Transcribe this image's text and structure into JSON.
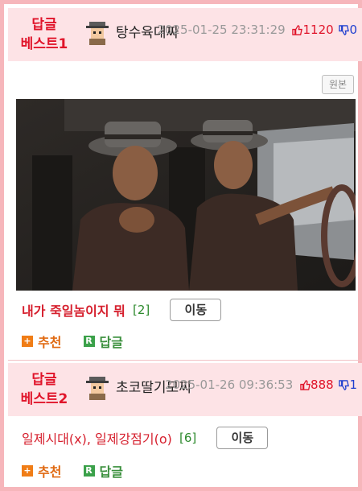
{
  "posts": [
    {
      "rank_line1": "답글",
      "rank_line2": "베스트1",
      "nickname": "탕수육대짜",
      "date": "2025-01-25 23:31:29",
      "upvotes": "1120",
      "downvotes": "0",
      "original_label": "원본",
      "title": "내가 죽일놈이지 뭐",
      "comment_count": "[2]",
      "move_label": "이동",
      "recommend_label": "추천",
      "reply_label": "답글"
    },
    {
      "rank_line1": "답글",
      "rank_line2": "베스트2",
      "nickname": "초코딸기모찌",
      "date": "2025-01-26 09:36:53",
      "upvotes": "888",
      "downvotes": "1",
      "title": "일제시대(x), 일제강점기(o)",
      "comment_count": "[6]",
      "move_label": "이동",
      "recommend_label": "추천",
      "reply_label": "답글"
    }
  ],
  "colors": {
    "border": "#f6b6bb",
    "header_bg": "#fde3e6",
    "rank": "#e0142a",
    "title": "#d6202e",
    "count": "#2d8a2d",
    "upvote": "#e0142a",
    "downvote": "#1f3fcf"
  },
  "icons": {
    "upvote": "thumbs-up-icon",
    "downvote": "thumbs-down-icon",
    "recommend": "plus-icon",
    "reply": "r-reply-icon"
  }
}
